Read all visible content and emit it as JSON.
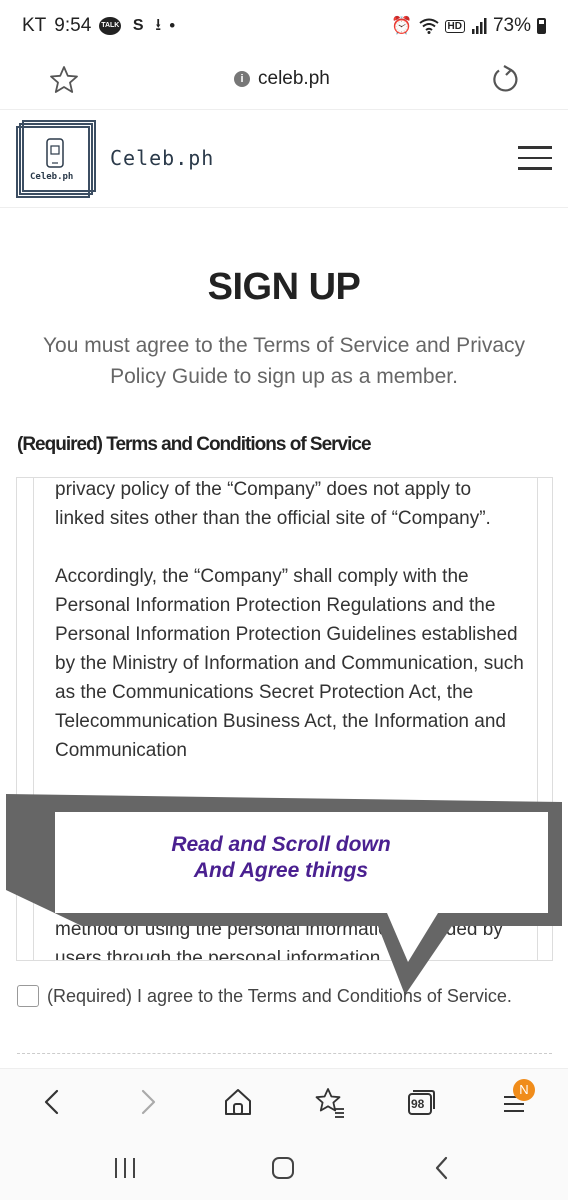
{
  "status_bar": {
    "carrier": "KT",
    "time": "9:54",
    "icons": [
      "talk-icon",
      "s-icon",
      "download-icon",
      "dot-icon",
      "alarm-icon",
      "wifi-icon",
      "hd-icon",
      "signal-icon"
    ],
    "talk_label": "TALK",
    "s_label": "S",
    "hd_label": "HD",
    "battery": "73%"
  },
  "browser": {
    "url": "celeb.ph",
    "tab_count": "98",
    "notification_badge": "N"
  },
  "site": {
    "logo_text": "Celeb.ph",
    "name": "Celeb.ph"
  },
  "main": {
    "title": "SIGN UP",
    "description": "You must agree to the Terms of Service and Privacy Policy Guide to sign up as a member.",
    "terms_section_title": "(Required) Terms and Conditions of Service",
    "terms_paragraphs": [
      "privacy policy of the “Company” does not apply to linked sites other than the official site of “Company”.",
      "Accordingly, the “Company” shall comply with the Personal Information Protection Regulations and the Personal Information Protection Guidelines established by the Ministry of Information and Communication, such as the Communications Secret Protection Act, the Telecommunication Business Act, the Information and Communication"
    ],
    "terms_tail": "method of using the personal information provided by users through the personal information",
    "agree_label": "(Required) I agree to the Terms and Conditions of Service."
  },
  "callout": {
    "line1": "Read and Scroll down",
    "line2": "And Agree things"
  },
  "colors": {
    "callout_text": "#4a2090",
    "callout_border": "#666666",
    "badge": "#f08c1a"
  }
}
